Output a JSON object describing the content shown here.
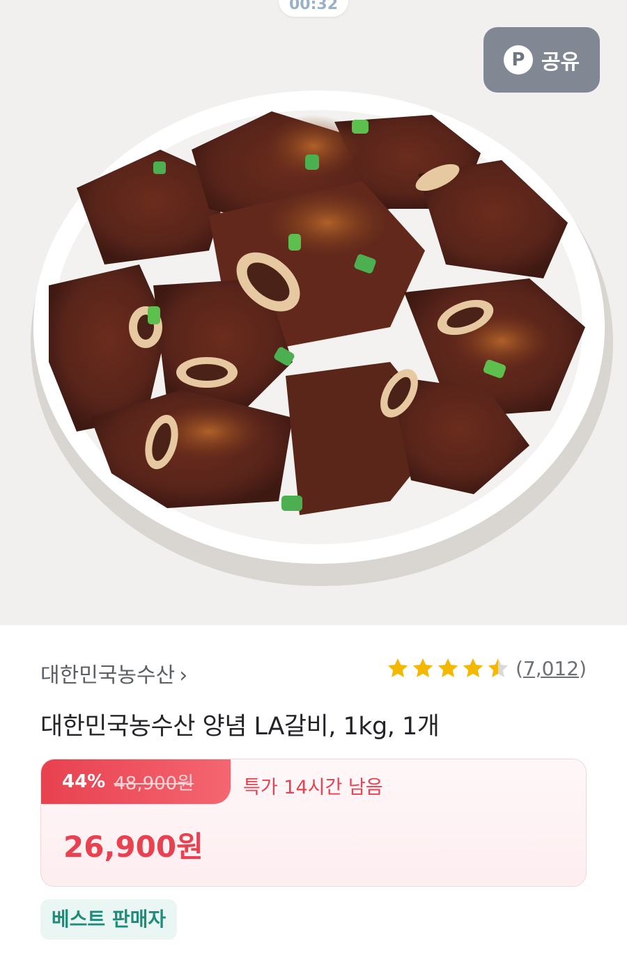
{
  "status": {
    "timer": "00:32"
  },
  "share": {
    "icon_letter": "P",
    "label": "공유"
  },
  "seller": {
    "name": "대한민국농수산",
    "chevron": "›"
  },
  "rating": {
    "stars": 4.5,
    "count_open": "(",
    "count": "7,012",
    "count_close": ")"
  },
  "product": {
    "title": "대한민국농수산 양념 LA갈비, 1kg, 1개"
  },
  "price": {
    "discount": "44%",
    "original": "48,900원",
    "deal": "특가 14시간 남음",
    "sale": "26,900원"
  },
  "badge": {
    "label": "베스트 판매자"
  },
  "colors": {
    "accent": "#e8414f",
    "star": "#f5b800",
    "badge_text": "#1e8c78"
  },
  "icons": {
    "share": "p-circle-icon",
    "star": "star-icon",
    "chevron": "chevron-right-icon"
  }
}
